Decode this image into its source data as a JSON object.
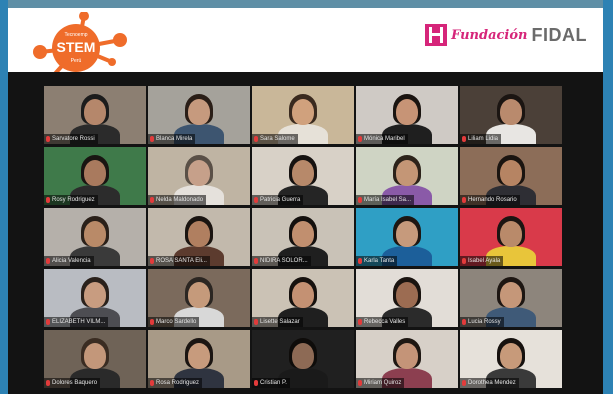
{
  "header": {
    "left_logo": {
      "small_top": "Tecnoemp",
      "word": "STEM",
      "small_bottom": "Perú"
    },
    "right_logo": {
      "fundacion": "Fundación",
      "fidal": "FIDAL"
    },
    "colors": {
      "orange": "#ef6c2a",
      "magenta": "#d6257a",
      "grey": "#6b6b6b"
    }
  },
  "participants": [
    {
      "name": "Sarvatore Rossi",
      "bg": "#8c7f72",
      "skin": "#b5876b",
      "shirt": "#2b2b2b",
      "hair": "#1c1c1c"
    },
    {
      "name": "Blanca Mirela",
      "bg": "#a5a29b",
      "skin": "#c69a7e",
      "shirt": "#3d5570",
      "hair": "#2a1e17"
    },
    {
      "name": "Sara Salome",
      "bg": "#c9b799",
      "skin": "#d0a17d",
      "shirt": "#e6e1d8",
      "hair": "#3a2a1f"
    },
    {
      "name": "Mónica Maribel",
      "bg": "#cfcac5",
      "skin": "#c79476",
      "shirt": "#1f1f1f",
      "hair": "#1a1410"
    },
    {
      "name": "Liliam Lidia",
      "bg": "#4b4038",
      "skin": "#b98a6d",
      "shirt": "#e8e6e3",
      "hair": "#1b1512"
    },
    {
      "name": "Rosy Rodriguez",
      "bg": "#3f7a4a",
      "skin": "#a97a5e",
      "shirt": "#2c2c2c",
      "hair": "#191512"
    },
    {
      "name": "Nelda Maldonado",
      "bg": "#bfb4a3",
      "skin": "#c6a08a",
      "shirt": "#e5e1dc",
      "hair": "#5a5047"
    },
    {
      "name": "Patricia Guerra",
      "bg": "#d8d1c7",
      "skin": "#b7896a",
      "shirt": "#252525",
      "hair": "#161210"
    },
    {
      "name": "María Isabel Sa...",
      "bg": "#cfd4c4",
      "skin": "#c49676",
      "shirt": "#8a5aa8",
      "hair": "#2c221a"
    },
    {
      "name": "Hernando Rosario",
      "bg": "#8c6d58",
      "skin": "#b68463",
      "shirt": "#2e2e34",
      "hair": "#1a1410"
    },
    {
      "name": "Alicia Valencia",
      "bg": "#b5b0aa",
      "skin": "#b98a68",
      "shirt": "#3a3a3a",
      "hair": "#2a2019"
    },
    {
      "name": "ROSA SANTA Eli...",
      "bg": "#c2b9ac",
      "skin": "#b07f60",
      "shirt": "#5c3b2e",
      "hair": "#1a1410"
    },
    {
      "name": "NIDIRA SOLOR...",
      "bg": "#c9c2b7",
      "skin": "#c18f6f",
      "shirt": "#1f1f1f",
      "hair": "#14100e"
    },
    {
      "name": "Karla Tanta",
      "bg": "#2f9fc5",
      "skin": "#c69a7c",
      "shirt": "#1c5f9a",
      "hair": "#1d1612"
    },
    {
      "name": "Isabel Ayala",
      "bg": "#d93a4a",
      "skin": "#b98a6a",
      "shirt": "#e8c53a",
      "hair": "#1b1512"
    },
    {
      "name": "ELIZABETH VILM...",
      "bg": "#b9bcc2",
      "skin": "#c89c80",
      "shirt": "#4d4d52",
      "hair": "#2a211b"
    },
    {
      "name": "Marco Sardello",
      "bg": "#7b6a5c",
      "skin": "#c59a7b",
      "shirt": "#d8d8d8",
      "hair": "#2b2622"
    },
    {
      "name": "Lisette Salazar",
      "bg": "#cbc2b5",
      "skin": "#c49173",
      "shirt": "#1f1f1f",
      "hair": "#16110e"
    },
    {
      "name": "Rebecca Valles",
      "bg": "#e2ddd7",
      "skin": "#9c6c52",
      "shirt": "#2b2b2b",
      "hair": "#1a1410"
    },
    {
      "name": "Lucia Rossy",
      "bg": "#8d857c",
      "skin": "#c59779",
      "shirt": "#3f5a78",
      "hair": "#1d1612"
    },
    {
      "name": "Dolores Baquero",
      "bg": "#6f6357",
      "skin": "#c3977a",
      "shirt": "#2a2a2a",
      "hair": "#3a2c22"
    },
    {
      "name": "Rosa Rodriguez",
      "bg": "#a89a87",
      "skin": "#c79b7d",
      "shirt": "#2f3440",
      "hair": "#1b1512"
    },
    {
      "name": "Cristian P.",
      "bg": "#202020",
      "skin": "#8d6a55",
      "shirt": "#1a1a1a",
      "hair": "#0e0c0a"
    },
    {
      "name": "Miriam Quiroz",
      "bg": "#d7d0c8",
      "skin": "#c49478",
      "shirt": "#8c3f50",
      "hair": "#1e1712"
    },
    {
      "name": "Dorothea Mendez",
      "bg": "#e6e1da",
      "skin": "#c79a7a",
      "shirt": "#3a3a3a",
      "hair": "#16110e"
    }
  ]
}
